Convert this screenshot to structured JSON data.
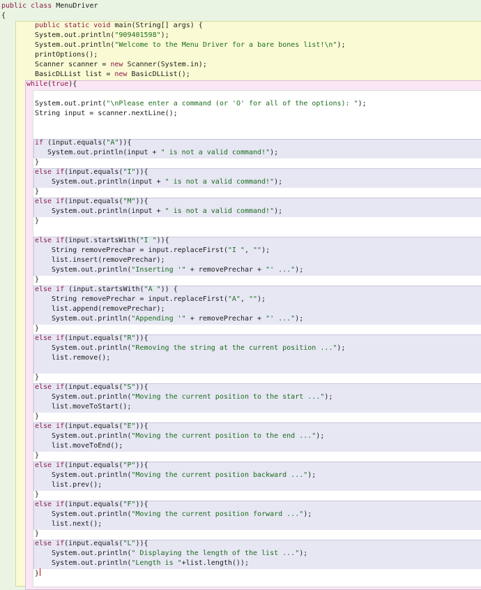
{
  "editor": {
    "lines": [
      [
        {
          "t": "public",
          "k": "kw"
        },
        {
          "t": " "
        },
        {
          "t": "class",
          "k": "kw"
        },
        {
          "t": " MenuDriver"
        }
      ],
      [
        {
          "t": "{"
        }
      ],
      [
        {
          "t": "public static void",
          "k": "kw"
        },
        {
          "t": " main(String[] args) {"
        }
      ],
      [
        {
          "t": "System.out.println("
        },
        {
          "t": "\"909401598\"",
          "k": "str"
        },
        {
          "t": ");"
        }
      ],
      [
        {
          "t": "System.out.println("
        },
        {
          "t": "\"Welcome to the Menu Driver for a bare bones list!\\n\"",
          "k": "str"
        },
        {
          "t": ");"
        }
      ],
      [
        {
          "t": "printOptions();"
        }
      ],
      [
        {
          "t": "Scanner scanner = "
        },
        {
          "t": "new",
          "k": "kw"
        },
        {
          "t": " Scanner(System.in);"
        }
      ],
      [
        {
          "t": "BasicDLList list = "
        },
        {
          "t": "new",
          "k": "kw"
        },
        {
          "t": " BasicDLList();"
        }
      ],
      [
        {
          "t": "while",
          "k": "kw"
        },
        {
          "t": "("
        },
        {
          "t": "true",
          "k": "kw"
        },
        {
          "t": "){"
        }
      ],
      [
        {
          "t": "System.out.print("
        },
        {
          "t": "\"\\nPlease enter a command (or 'O' for all of the options): \"",
          "k": "str"
        },
        {
          "t": ");"
        }
      ],
      [
        {
          "t": "String input = scanner.nextLine();"
        }
      ],
      [
        {
          "t": "if",
          "k": "kw"
        },
        {
          "t": " (input.equals("
        },
        {
          "t": "\"A\"",
          "k": "str"
        },
        {
          "t": ")){"
        }
      ],
      [
        {
          "t": "System.out.println(input + "
        },
        {
          "t": "\" is not a valid command!\"",
          "k": "str"
        },
        {
          "t": ");"
        }
      ],
      [
        {
          "t": "}"
        }
      ],
      [
        {
          "t": "else if",
          "k": "kw"
        },
        {
          "t": "(input.equals("
        },
        {
          "t": "\"I\"",
          "k": "str"
        },
        {
          "t": ")){"
        }
      ],
      [
        {
          "t": "System.out.println(input + "
        },
        {
          "t": "\" is not a valid command!\"",
          "k": "str"
        },
        {
          "t": ");"
        }
      ],
      [
        {
          "t": "}"
        }
      ],
      [
        {
          "t": "else if",
          "k": "kw"
        },
        {
          "t": "(input.equals("
        },
        {
          "t": "\"M\"",
          "k": "str"
        },
        {
          "t": ")){"
        }
      ],
      [
        {
          "t": "System.out.println(input + "
        },
        {
          "t": "\" is not a valid command!\"",
          "k": "str"
        },
        {
          "t": ");"
        }
      ],
      [
        {
          "t": "}"
        }
      ],
      [
        {
          "t": "else if",
          "k": "kw"
        },
        {
          "t": "(input.startsWith("
        },
        {
          "t": "\"I \"",
          "k": "str"
        },
        {
          "t": ")){"
        }
      ],
      [
        {
          "t": "String removePrechar = input.replaceFirst("
        },
        {
          "t": "\"I \"",
          "k": "str"
        },
        {
          "t": ", "
        },
        {
          "t": "\"\"",
          "k": "str"
        },
        {
          "t": ");"
        }
      ],
      [
        {
          "t": "list.insert(removePrechar);"
        }
      ],
      [
        {
          "t": "System.out.println("
        },
        {
          "t": "\"Inserting '\"",
          "k": "str"
        },
        {
          "t": " + removePrechar + "
        },
        {
          "t": "\"' ...\"",
          "k": "str"
        },
        {
          "t": ");"
        }
      ],
      [
        {
          "t": "}"
        }
      ],
      [
        {
          "t": "else if",
          "k": "kw"
        },
        {
          "t": " (input.startsWith("
        },
        {
          "t": "\"A \"",
          "k": "str"
        },
        {
          "t": ")) {"
        }
      ],
      [
        {
          "t": "String removePrechar = input.replaceFirst("
        },
        {
          "t": "\"A\"",
          "k": "str"
        },
        {
          "t": ", "
        },
        {
          "t": "\"\"",
          "k": "str"
        },
        {
          "t": ");"
        }
      ],
      [
        {
          "t": "list.append(removePrechar);"
        }
      ],
      [
        {
          "t": "System.out.println("
        },
        {
          "t": "\"Appending '\"",
          "k": "str"
        },
        {
          "t": " + removePrechar + "
        },
        {
          "t": "\"' ...\"",
          "k": "str"
        },
        {
          "t": ");"
        }
      ],
      [
        {
          "t": "}"
        }
      ],
      [
        {
          "t": "else if",
          "k": "kw"
        },
        {
          "t": "(input.equals("
        },
        {
          "t": "\"R\"",
          "k": "str"
        },
        {
          "t": ")){"
        }
      ],
      [
        {
          "t": "System.out.println("
        },
        {
          "t": "\"Removing the string at the current position ...\"",
          "k": "str"
        },
        {
          "t": ");"
        }
      ],
      [
        {
          "t": "list.remove();"
        }
      ],
      [
        {
          "t": "}"
        }
      ],
      [
        {
          "t": "else if",
          "k": "kw"
        },
        {
          "t": "(input.equals("
        },
        {
          "t": "\"S\"",
          "k": "str"
        },
        {
          "t": ")){"
        }
      ],
      [
        {
          "t": "System.out.println("
        },
        {
          "t": "\"Moving the current position to the start ...\"",
          "k": "str"
        },
        {
          "t": ");"
        }
      ],
      [
        {
          "t": "list.moveToStart();"
        }
      ],
      [
        {
          "t": "}"
        }
      ],
      [
        {
          "t": "else if",
          "k": "kw"
        },
        {
          "t": "(input.equals("
        },
        {
          "t": "\"E\"",
          "k": "str"
        },
        {
          "t": ")){"
        }
      ],
      [
        {
          "t": "System.out.println("
        },
        {
          "t": "\"Moving the current position to the end ...\"",
          "k": "str"
        },
        {
          "t": ");"
        }
      ],
      [
        {
          "t": "list.moveToEnd();"
        }
      ],
      [
        {
          "t": "}"
        }
      ],
      [
        {
          "t": "else if",
          "k": "kw"
        },
        {
          "t": "(input.equals("
        },
        {
          "t": "\"P\"",
          "k": "str"
        },
        {
          "t": ")){"
        }
      ],
      [
        {
          "t": "System.out.println("
        },
        {
          "t": "\"Moving the current position backward ...\"",
          "k": "str"
        },
        {
          "t": ");"
        }
      ],
      [
        {
          "t": "list.prev();"
        }
      ],
      [
        {
          "t": "}"
        }
      ],
      [
        {
          "t": "else if",
          "k": "kw"
        },
        {
          "t": "(input.equals("
        },
        {
          "t": "\"F\"",
          "k": "str"
        },
        {
          "t": ")){"
        }
      ],
      [
        {
          "t": "System.out.println("
        },
        {
          "t": "\"Moving the current position forward ...\"",
          "k": "str"
        },
        {
          "t": ");"
        }
      ],
      [
        {
          "t": "list.next();"
        }
      ],
      [
        {
          "t": "}"
        }
      ],
      [
        {
          "t": "else if",
          "k": "kw"
        },
        {
          "t": "(input.equals("
        },
        {
          "t": "\"L\"",
          "k": "str"
        },
        {
          "t": ")){"
        }
      ],
      [
        {
          "t": "System.out.println("
        },
        {
          "t": "\" Displaying the length of the list ...\"",
          "k": "str"
        },
        {
          "t": ");"
        }
      ],
      [
        {
          "t": "System.out.println("
        },
        {
          "t": "\"Length is \"",
          "k": "str"
        },
        {
          "t": "+list.length());"
        }
      ],
      [
        {
          "t": "}"
        }
      ]
    ],
    "colors": {
      "class_scope": "#e9f4e3",
      "method_scope": "#fafbd4",
      "loop_scope": "#fbe6f5",
      "branch_scope": "#e7e7f4",
      "body": "#ffffff",
      "keyword": "#8b1a4a",
      "string": "#1c6b1c",
      "cursor": "#c00000"
    }
  }
}
